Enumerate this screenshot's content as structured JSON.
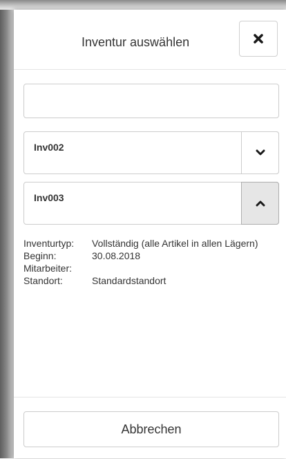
{
  "dialog": {
    "title": "Inventur auswählen",
    "close_icon": "close-icon"
  },
  "search": {
    "value": "",
    "placeholder": ""
  },
  "inventories": [
    {
      "name": "Inv002",
      "expanded": false,
      "toggle_icon": "chevron-down-icon"
    },
    {
      "name": "Inv003",
      "expanded": true,
      "toggle_icon": "chevron-up-icon"
    }
  ],
  "details": {
    "type_label": "Inventurtyp:",
    "type_value": "Vollständig (alle Artikel in allen Lägern)",
    "start_label": "Beginn:",
    "start_value": "30.08.2018",
    "employee_label": "Mitarbeiter:",
    "employee_value": "",
    "location_label": "Standort:",
    "location_value": "Standardstandort"
  },
  "footer": {
    "cancel_label": "Abbrechen"
  },
  "colors": {
    "border": "#cccccc",
    "active_toggle_bg": "#e6e6e6",
    "text": "#333333"
  }
}
